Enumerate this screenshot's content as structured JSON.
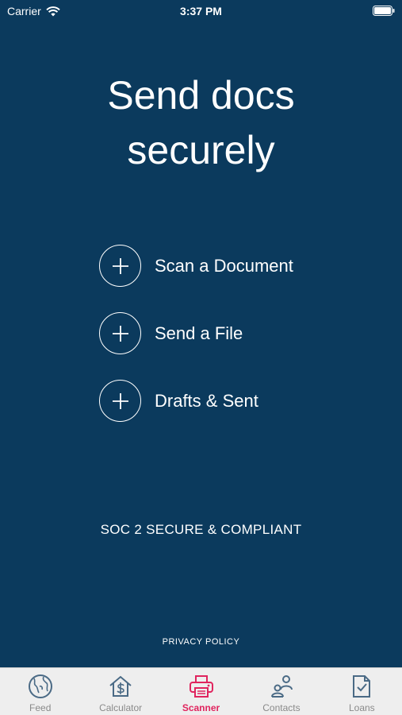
{
  "status_bar": {
    "carrier": "Carrier",
    "time": "3:37 PM"
  },
  "hero": {
    "line1": "Send docs",
    "line2": "securely"
  },
  "actions": [
    {
      "label": "Scan a Document",
      "icon": "plus-icon"
    },
    {
      "label": "Send a File",
      "icon": "plus-icon"
    },
    {
      "label": "Drafts & Sent",
      "icon": "plus-icon"
    }
  ],
  "compliance": "SOC 2 SECURE & COMPLIANT",
  "privacy": "PRIVACY POLICY",
  "tabs": [
    {
      "label": "Feed",
      "icon": "globe-icon",
      "active": false
    },
    {
      "label": "Calculator",
      "icon": "house-dollar-icon",
      "active": false
    },
    {
      "label": "Scanner",
      "icon": "printer-icon",
      "active": true
    },
    {
      "label": "Contacts",
      "icon": "contacts-icon",
      "active": false
    },
    {
      "label": "Loans",
      "icon": "document-check-icon",
      "active": false
    }
  ],
  "colors": {
    "background": "#0b3a5d",
    "accent": "#e0245e",
    "tab_inactive": "#4a6a85"
  }
}
